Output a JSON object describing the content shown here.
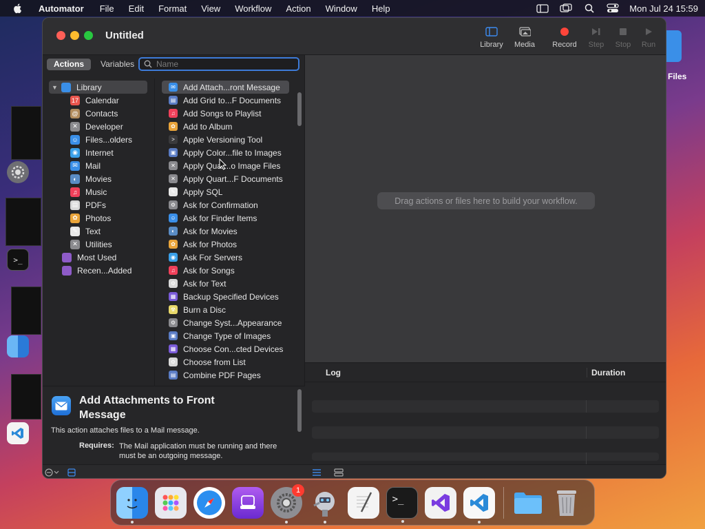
{
  "menubar": {
    "app_name": "Automator",
    "items": [
      "File",
      "Edit",
      "Format",
      "View",
      "Workflow",
      "Action",
      "Window",
      "Help"
    ],
    "clock": "Mon Jul 24  15:59"
  },
  "desktop": {
    "files_label": "Files"
  },
  "window": {
    "title": "Untitled",
    "toolbar": {
      "library": "Library",
      "media": "Media",
      "record": "Record",
      "step": "Step",
      "stop": "Stop",
      "run": "Run"
    },
    "tabs": {
      "actions": "Actions",
      "variables": "Variables"
    },
    "search": {
      "placeholder": "Name"
    },
    "library": {
      "root": "Library",
      "categories": [
        {
          "label": "Calendar",
          "icon": "calendar-icon",
          "color": "#e9554d"
        },
        {
          "label": "Contacts",
          "icon": "contacts-icon",
          "color": "#b28c5e"
        },
        {
          "label": "Developer",
          "icon": "developer-icon",
          "color": "#8a8a8e"
        },
        {
          "label": "Files...olders",
          "icon": "finder-icon",
          "color": "#3a8fe8"
        },
        {
          "label": "Internet",
          "icon": "internet-icon",
          "color": "#3aa0e8"
        },
        {
          "label": "Mail",
          "icon": "mail-icon",
          "color": "#3a8fe8"
        },
        {
          "label": "Movies",
          "icon": "movies-icon",
          "color": "#5a8cc4"
        },
        {
          "label": "Music",
          "icon": "music-icon",
          "color": "#f0405a"
        },
        {
          "label": "PDFs",
          "icon": "pdf-icon",
          "color": "#d9d9d9"
        },
        {
          "label": "Photos",
          "icon": "photos-icon",
          "color": "#e9a43a"
        },
        {
          "label": "Text",
          "icon": "text-icon",
          "color": "#e8e8e8"
        },
        {
          "label": "Utilities",
          "icon": "utilities-icon",
          "color": "#8a8a8e"
        }
      ],
      "smart": [
        {
          "label": "Most Used",
          "icon": "folder-icon",
          "color": "#8e5bc8"
        },
        {
          "label": "Recen...Added",
          "icon": "folder-icon",
          "color": "#8e5bc8"
        }
      ]
    },
    "actions": [
      {
        "label": "Add Attach...ront Message",
        "icon": "mail-icon",
        "color": "#3a8fe8"
      },
      {
        "label": "Add Grid to...F Documents",
        "icon": "pdf-icon",
        "color": "#5a7cc4"
      },
      {
        "label": "Add Songs to Playlist",
        "icon": "music-icon",
        "color": "#f0405a"
      },
      {
        "label": "Add to Album",
        "icon": "photos-icon",
        "color": "#e9a43a"
      },
      {
        "label": "Apple Versioning Tool",
        "icon": "terminal-icon",
        "color": "#3a3a3c"
      },
      {
        "label": "Apply Color...file to Images",
        "icon": "preview-icon",
        "color": "#5a7cc4"
      },
      {
        "label": "Apply Quar...o Image Files",
        "icon": "developer-icon",
        "color": "#8a8a8e"
      },
      {
        "label": "Apply Quart...F Documents",
        "icon": "developer-icon",
        "color": "#8a8a8e"
      },
      {
        "label": "Apply SQL",
        "icon": "script-icon",
        "color": "#e8e8e8"
      },
      {
        "label": "Ask for Confirmation",
        "icon": "automator-icon",
        "color": "#8a8a8e"
      },
      {
        "label": "Ask for Finder Items",
        "icon": "finder-icon",
        "color": "#3a8fe8"
      },
      {
        "label": "Ask for Movies",
        "icon": "movies-icon",
        "color": "#5a8cc4"
      },
      {
        "label": "Ask for Photos",
        "icon": "photos-icon",
        "color": "#e9a43a"
      },
      {
        "label": "Ask For Servers",
        "icon": "network-icon",
        "color": "#3aa0e8"
      },
      {
        "label": "Ask for Songs",
        "icon": "music-icon",
        "color": "#f0405a"
      },
      {
        "label": "Ask for Text",
        "icon": "automator-icon",
        "color": "#d9d9d9"
      },
      {
        "label": "Backup Specified Devices",
        "icon": "configurator-icon",
        "color": "#7a5bd8"
      },
      {
        "label": "Burn a Disc",
        "icon": "burn-icon",
        "color": "#e8d86a"
      },
      {
        "label": "Change Syst...Appearance",
        "icon": "settings-icon",
        "color": "#8a8a8e"
      },
      {
        "label": "Change Type of Images",
        "icon": "preview-icon",
        "color": "#5a7cc4"
      },
      {
        "label": "Choose Con...cted Devices",
        "icon": "configurator-icon",
        "color": "#7a5bd8"
      },
      {
        "label": "Choose from List",
        "icon": "automator-icon",
        "color": "#d9d9d9"
      },
      {
        "label": "Combine PDF Pages",
        "icon": "pdf-icon",
        "color": "#5a7cc4"
      }
    ],
    "description": {
      "title": "Add Attachments to Front Message",
      "summary": "This action attaches files to a Mail message.",
      "requires_label": "Requires:",
      "requires_text": "The Mail application must be running and there must be an outgoing message."
    },
    "workflow": {
      "drop_hint": "Drag actions or files here to build your workflow."
    },
    "log": {
      "col_log": "Log",
      "col_duration": "Duration"
    }
  },
  "dock": {
    "apps": [
      "finder-icon",
      "launchpad-icon",
      "safari-icon",
      "podcasts-icon",
      "settings-icon",
      "automator-icon",
      "textedit-icon",
      "terminal-icon",
      "visual-studio-icon",
      "vscode-icon"
    ],
    "settings_badge": "1",
    "colors": {
      "accent": "#3d7bd9",
      "record": "#ff453a"
    }
  }
}
